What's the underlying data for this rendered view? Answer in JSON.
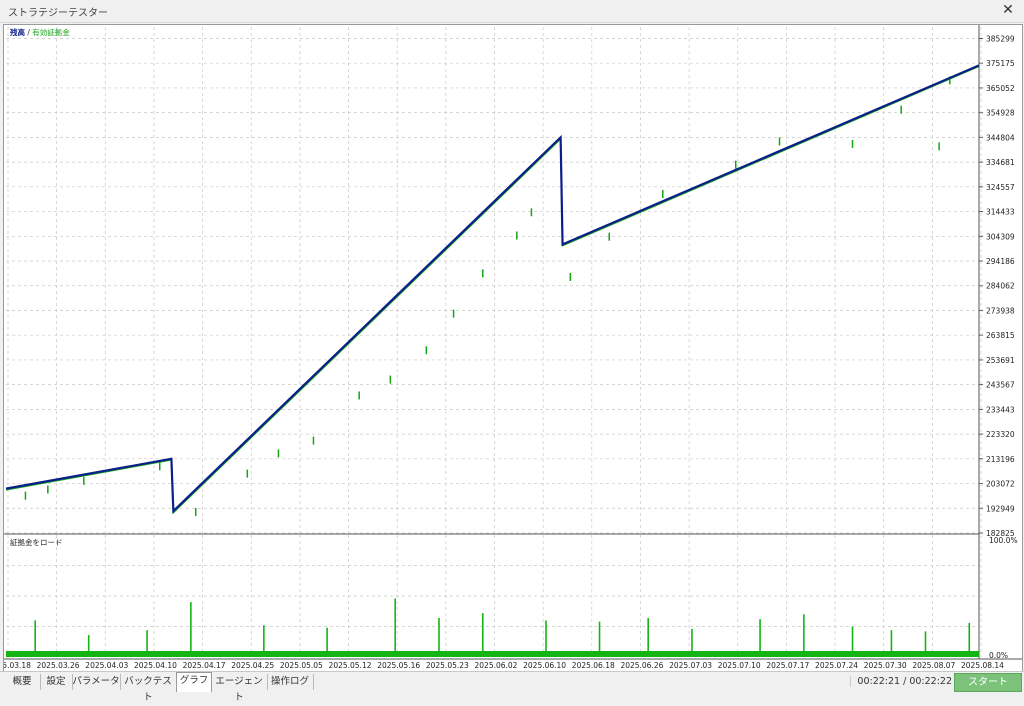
{
  "window": {
    "title": "ストラテジーテスター",
    "close_label": "✕"
  },
  "legend": {
    "balance": "残高",
    "sep": " / ",
    "equity": "有効証拠金"
  },
  "lower_panel": {
    "label": "証拠金をロード",
    "top_label": "100.0%",
    "bottom_label": "0.0%"
  },
  "tabs": [
    {
      "label": "概要",
      "active": false
    },
    {
      "label": "設定",
      "active": false
    },
    {
      "label": "パラメータ",
      "active": false
    },
    {
      "label": "バックテスト",
      "active": false
    },
    {
      "label": "グラフ",
      "active": true
    },
    {
      "label": "エージェント",
      "active": false
    },
    {
      "label": "操作ログ",
      "active": false
    }
  ],
  "status": {
    "time": "00:22:21 / 00:22:22",
    "start_button": "スタート"
  },
  "colors": {
    "balance": "#0b1f8a",
    "equity": "#14a514",
    "grid": "#c8c8c8",
    "load": "#14b414"
  },
  "chart_data": [
    {
      "type": "line",
      "title": "",
      "series": [
        {
          "name": "残高",
          "x": [
            0,
            17,
            17.2,
            57,
            57.2,
            100
          ],
          "y": [
            201000,
            213200,
            191800,
            344800,
            301000,
            374300
          ]
        },
        {
          "name": "有効証拠金",
          "x": [
            0,
            17,
            17.2,
            57,
            57.2,
            100
          ],
          "y": [
            200500,
            212800,
            191200,
            344200,
            300500,
            373900
          ]
        }
      ],
      "equity_dips": [
        {
          "x": 2.0,
          "y": 196500
        },
        {
          "x": 4.3,
          "y": 199000
        },
        {
          "x": 8.0,
          "y": 202500
        },
        {
          "x": 15.8,
          "y": 208500
        },
        {
          "x": 19.5,
          "y": 189800
        },
        {
          "x": 24.8,
          "y": 205500
        },
        {
          "x": 28.0,
          "y": 213800
        },
        {
          "x": 31.6,
          "y": 219000
        },
        {
          "x": 36.3,
          "y": 237500
        },
        {
          "x": 39.5,
          "y": 244000
        },
        {
          "x": 43.2,
          "y": 256000
        },
        {
          "x": 46.0,
          "y": 271000
        },
        {
          "x": 49.0,
          "y": 287500
        },
        {
          "x": 52.5,
          "y": 303000
        },
        {
          "x": 54.0,
          "y": 312500
        },
        {
          "x": 58.0,
          "y": 286000
        },
        {
          "x": 62.0,
          "y": 302500
        },
        {
          "x": 67.5,
          "y": 320000
        },
        {
          "x": 75.0,
          "y": 332000
        },
        {
          "x": 79.5,
          "y": 341500
        },
        {
          "x": 87.0,
          "y": 340500
        },
        {
          "x": 92.0,
          "y": 354500
        },
        {
          "x": 95.9,
          "y": 339500
        },
        {
          "x": 97.0,
          "y": 366500
        }
      ],
      "ylim": [
        182825,
        390000
      ],
      "yticks": [
        385299,
        375175,
        365052,
        354928,
        344804,
        334681,
        324557,
        314433,
        304309,
        294186,
        284062,
        273938,
        263815,
        253691,
        243567,
        233443,
        223320,
        213196,
        203072,
        192949,
        182825
      ],
      "xticks": [
        "2025.03.18",
        "2025.03.26",
        "2025.04.03",
        "2025.04.10",
        "2025.04.17",
        "2025.04.25",
        "2025.05.05",
        "2025.05.12",
        "2025.05.16",
        "2025.05.23",
        "2025.06.02",
        "2025.06.10",
        "2025.06.18",
        "2025.06.26",
        "2025.07.03",
        "2025.07.10",
        "2025.07.17",
        "2025.07.24",
        "2025.07.30",
        "2025.08.07",
        "2025.08.14"
      ],
      "grid": true
    },
    {
      "type": "bar",
      "title": "証拠金をロード",
      "ylim": [
        0,
        100
      ],
      "spikes": [
        {
          "x": 3.0,
          "y": 30
        },
        {
          "x": 8.5,
          "y": 18
        },
        {
          "x": 14.5,
          "y": 22
        },
        {
          "x": 19.0,
          "y": 45
        },
        {
          "x": 26.5,
          "y": 26
        },
        {
          "x": 33.0,
          "y": 24
        },
        {
          "x": 40.0,
          "y": 48
        },
        {
          "x": 44.5,
          "y": 32
        },
        {
          "x": 49.0,
          "y": 36
        },
        {
          "x": 55.5,
          "y": 30
        },
        {
          "x": 61.0,
          "y": 29
        },
        {
          "x": 66.0,
          "y": 32
        },
        {
          "x": 70.5,
          "y": 23
        },
        {
          "x": 77.5,
          "y": 31
        },
        {
          "x": 82.0,
          "y": 35
        },
        {
          "x": 87.0,
          "y": 25
        },
        {
          "x": 91.0,
          "y": 22
        },
        {
          "x": 94.5,
          "y": 21
        },
        {
          "x": 99.0,
          "y": 28
        }
      ]
    }
  ]
}
